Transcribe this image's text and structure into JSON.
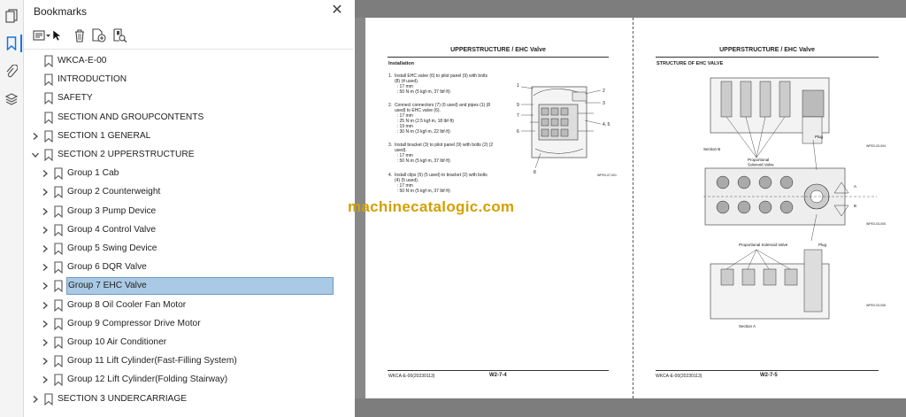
{
  "sidebar_tools": [
    {
      "name": "pages-icon"
    },
    {
      "name": "bookmarks-icon"
    },
    {
      "name": "attachments-icon"
    },
    {
      "name": "layers-icon"
    }
  ],
  "panel": {
    "title": "Bookmarks",
    "close_label": "✕"
  },
  "bookmarks": [
    {
      "label": "WKCA-E-00",
      "level": 0,
      "expander": "none"
    },
    {
      "label": "INTRODUCTION",
      "level": 0,
      "expander": "none"
    },
    {
      "label": "SAFETY",
      "level": 0,
      "expander": "none"
    },
    {
      "label": "SECTION AND GROUPCONTENTS",
      "level": 0,
      "expander": "none"
    },
    {
      "label": "SECTION 1 GENERAL",
      "level": 0,
      "expander": "collapsed"
    },
    {
      "label": "SECTION 2 UPPERSTRUCTURE",
      "level": 0,
      "expander": "expanded"
    },
    {
      "label": "Group 1 Cab",
      "level": 1,
      "expander": "collapsed"
    },
    {
      "label": "Group 2 Counterweight",
      "level": 1,
      "expander": "collapsed"
    },
    {
      "label": "Group 3 Pump Device",
      "level": 1,
      "expander": "collapsed"
    },
    {
      "label": "Group 4 Control Valve",
      "level": 1,
      "expander": "collapsed"
    },
    {
      "label": "Group 5 Swing Device",
      "level": 1,
      "expander": "collapsed"
    },
    {
      "label": "Group 6 DQR Valve",
      "level": 1,
      "expander": "collapsed"
    },
    {
      "label": "Group 7 EHC Valve",
      "level": 1,
      "expander": "collapsed",
      "selected": true
    },
    {
      "label": "Group 8 Oil Cooler Fan Motor",
      "level": 1,
      "expander": "collapsed"
    },
    {
      "label": "Group 9 Compressor Drive Motor",
      "level": 1,
      "expander": "collapsed"
    },
    {
      "label": "Group 10 Air Conditioner",
      "level": 1,
      "expander": "collapsed"
    },
    {
      "label": "Group 11 Lift Cylinder(Fast-Filling System)",
      "level": 1,
      "expander": "collapsed"
    },
    {
      "label": "Group 12 Lift Cylinder(Folding Stairway)",
      "level": 1,
      "expander": "collapsed"
    },
    {
      "label": "SECTION 3 UNDERCARRIAGE",
      "level": 0,
      "expander": "collapsed"
    }
  ],
  "watermark": "machinecatalogic.com",
  "left_page": {
    "title": "UPPERSTRUCTURE / EHC Valve",
    "section": "Installation",
    "steps": [
      "1.  Install EHC valve (6) to pilot panel (9) with bolts\n     (8) (4 used).\n       : 17 mm\n       : 50 N·m (5 kgf·m, 37 lbf·ft)",
      "2.  Connect connectors (7) (6 used) and pipes (1) (8\n     used) to EHC valve (6).\n       : 17 mm\n       : 25 N·m (2.5 kgf·m, 18 lbf·ft)\n       : 19 mm\n       : 30 N·m (3 kgf·m, 22 lbf·ft)",
      "3.  Install bracket (3) to pilot panel (9) with bolts (2) (2\n     used).\n       : 17 mm\n       : 50 N·m (5 kgf·m, 37 lbf·ft)",
      "4.  Install clips (5) (5 used) to bracket (2) with bolts\n     (4) (5 used).\n       : 17 mm\n       : 50 N·m (5 kgf·m, 37 lbf·ft)"
    ],
    "callouts": [
      "1",
      "2",
      "3",
      "4, 5",
      "6",
      "7",
      "8",
      "9"
    ],
    "fig_code": "WPE0-07-001",
    "footer_code": "WKCA-E-00(20230113)",
    "page_num": "W2-7-4"
  },
  "right_page": {
    "title": "UPPERSTRUCTURE / EHC Valve",
    "section": "STRUCTURE OF EHC VALVE",
    "labels": {
      "section_b": "Section B",
      "prop_valve_1": "Proportional\nSolenoid Valve",
      "plug_1": "Plug",
      "a": "A",
      "b": "B",
      "prop_valve_2": "Proportional Solenoid Valve",
      "plug_2": "Plug",
      "section_a": "Section A"
    },
    "fig_codes": [
      "WPE0-03-004",
      "WPE0-03-005",
      "WPE0-03-006"
    ],
    "footer_code": "WKCA-E-00(20230113)",
    "page_num": "W2-7-5"
  }
}
